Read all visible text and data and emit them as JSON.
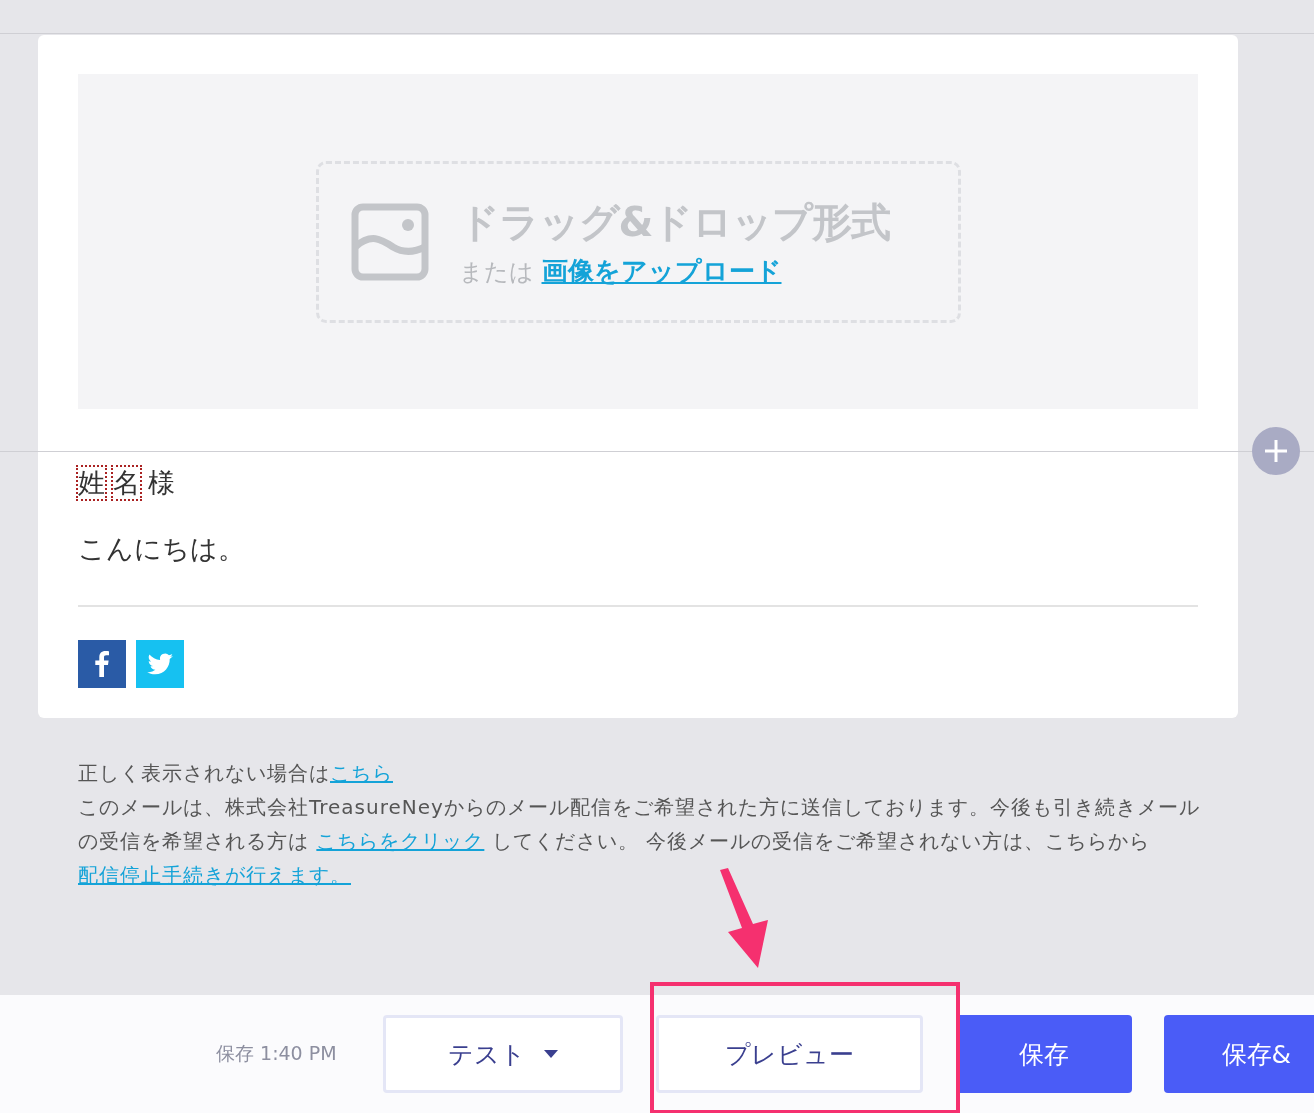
{
  "upload": {
    "title": "ドラッグ&ドロップ形式",
    "prefix": "または",
    "link": "画像をアップロード"
  },
  "greeting": {
    "tokens": [
      {
        "text": "姓",
        "kind": "merge-tag"
      },
      {
        "text": "名",
        "kind": "merge-tag"
      },
      {
        "text": "様",
        "kind": "plain"
      }
    ],
    "message": "こんにちは。"
  },
  "social": [
    {
      "kind": "facebook"
    },
    {
      "kind": "twitter"
    }
  ],
  "footer": [
    [
      {
        "text": "正しく表示されない場合は",
        "kind": "text"
      },
      {
        "text": "こちら",
        "kind": "link"
      }
    ],
    [
      {
        "text": "このメールは、株式会社TreasureNeyからのメール配信をご希望された方に送信しております。今後も引き続きメールの受信を希望される方は ",
        "kind": "text"
      },
      {
        "text": "こちらをクリック",
        "kind": "link"
      },
      {
        "text": " してください。 今後メールの受信をご希望されない方は、こちらから",
        "kind": "text"
      },
      {
        "text": "配信停止手続きが行えます。 ",
        "kind": "link"
      }
    ]
  ],
  "toolbar": {
    "status": "保存 1:40 PM",
    "buttons": [
      {
        "label": "テスト",
        "kind": "dropdown"
      },
      {
        "label": "プレビュー",
        "kind": "outline"
      },
      {
        "label": "保存",
        "kind": "primary"
      },
      {
        "label": "保存&",
        "kind": "primary"
      }
    ]
  }
}
